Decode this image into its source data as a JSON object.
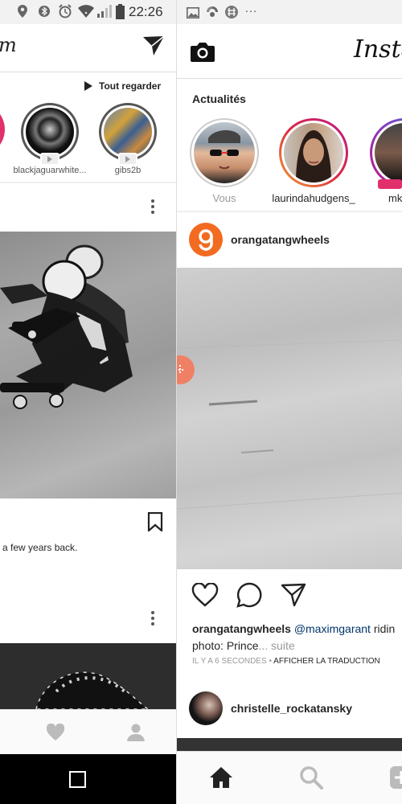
{
  "left": {
    "header_title_fragment": "m",
    "see_all_label": "Tout regarder",
    "stories": [
      {
        "label": "blackjaguarwhite..."
      },
      {
        "label": "gibs2b"
      }
    ],
    "caption_fragment": "a few years back."
  },
  "right": {
    "status_time": "22:26",
    "header_title": "Insta",
    "stories_title": "Actualités",
    "stories": [
      {
        "label": "Vous"
      },
      {
        "label": "laurindahudgens_"
      },
      {
        "label": "mk"
      }
    ],
    "post": {
      "author": "orangatangwheels",
      "caption_user": "orangatangwheels",
      "caption_mention": "@maximgarant",
      "caption_rest": " ridin",
      "caption_line2": "photo: Prince",
      "caption_more": "... suite",
      "time": "IL Y A 6 SECONDES",
      "translate": "AFFICHER LA TRADUCTION"
    },
    "next_post_author": "christelle_rockatansky"
  },
  "colors": {
    "accent_orange": "#f26b21",
    "mention_blue": "#003569"
  }
}
